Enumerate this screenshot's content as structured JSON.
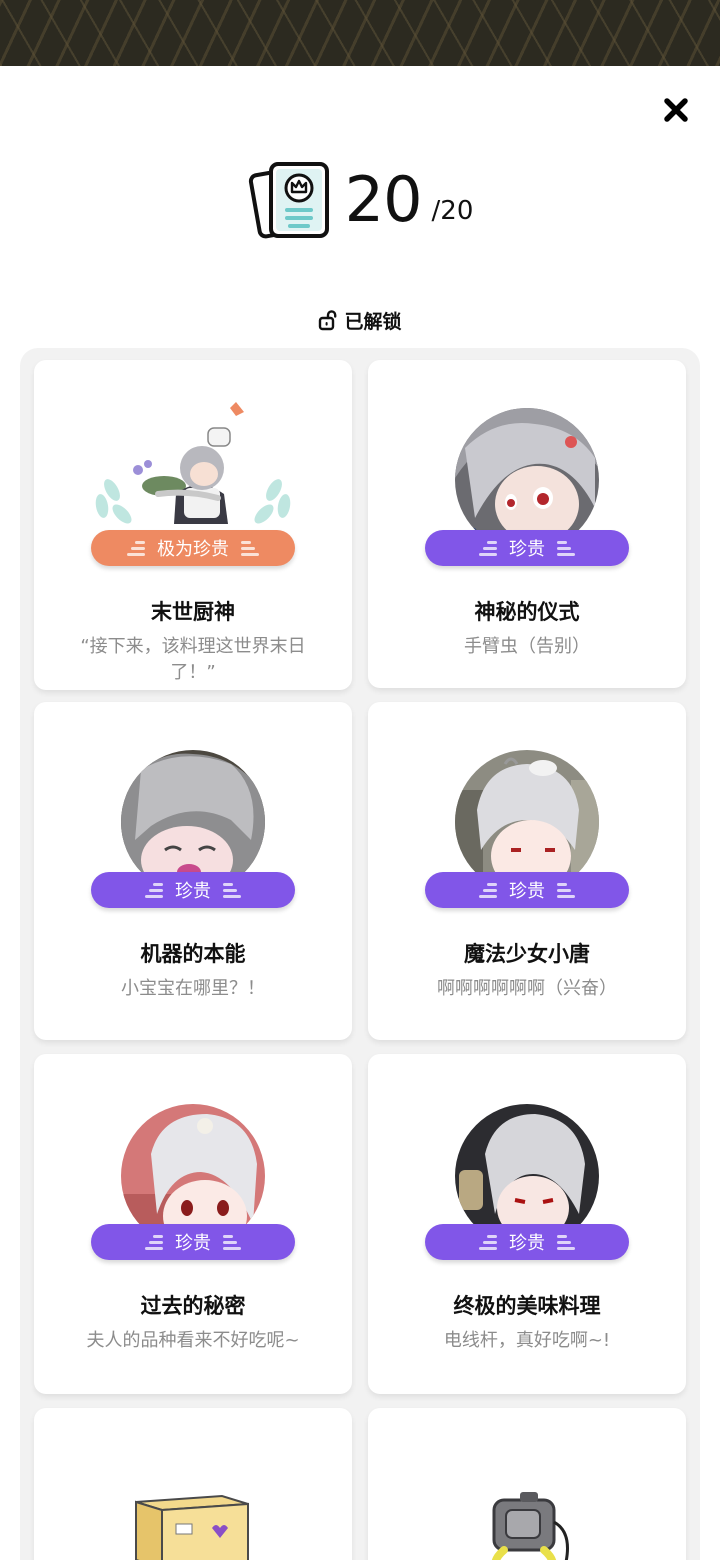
{
  "header": {
    "count": "20",
    "total": "/20"
  },
  "section": {
    "unlocked_label": "已解锁"
  },
  "cards": [
    {
      "rarity": "极为珍贵",
      "title": "末世厨神",
      "desc": "“接下来，该料理这世界末日了！”",
      "colors": {
        "badge": "#ee8a62"
      }
    },
    {
      "rarity": "珍贵",
      "title": "神秘的仪式",
      "desc": "手臂虫（告别）",
      "colors": {
        "badge": "#8156e8"
      }
    },
    {
      "rarity": "珍贵",
      "title": "机器的本能",
      "desc": "小宝宝在哪里？！",
      "colors": {
        "badge": "#8156e8"
      }
    },
    {
      "rarity": "珍贵",
      "title": "魔法少女小唐",
      "desc": "啊啊啊啊啊啊（兴奋）",
      "colors": {
        "badge": "#8156e8"
      }
    },
    {
      "rarity": "珍贵",
      "title": "过去的秘密",
      "desc": "夫人的品种看来不好吃呢~",
      "colors": {
        "badge": "#8156e8"
      }
    },
    {
      "rarity": "珍贵",
      "title": "终极的美味料理",
      "desc": "电线杆，真好吃啊~!",
      "colors": {
        "badge": "#8156e8"
      }
    }
  ]
}
